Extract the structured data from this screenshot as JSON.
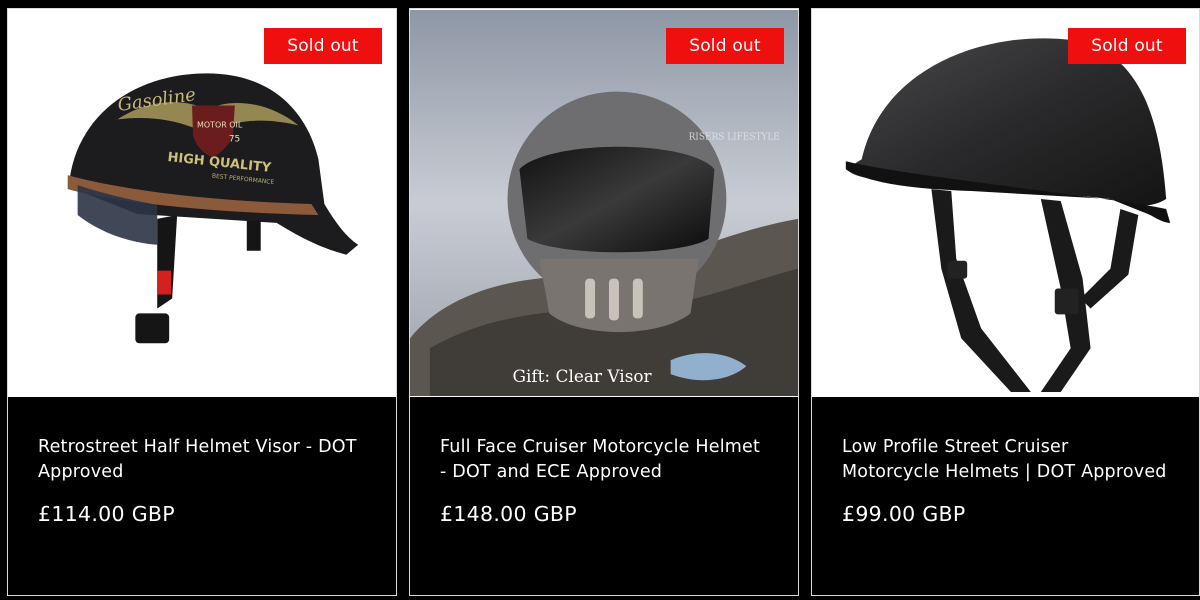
{
  "products": [
    {
      "badge": "Sold out",
      "title": "Retrostreet Half Helmet Visor - DOT Approved",
      "price": "£114.00 GBP",
      "image_text": {
        "brand": "Gasoline",
        "shield": "MOTOR OIL",
        "number": "75",
        "slogan": "HIGH QUALITY",
        "sub": "BEST PERFORMANCE"
      }
    },
    {
      "badge": "Sold out",
      "title": "Full Face Cruiser Motorcycle Helmet - DOT and ECE Approved",
      "price": "£148.00 GBP",
      "image_text": {
        "watermark": "RISERS LIFESTYLE",
        "caption": "Gift: Clear Visor"
      }
    },
    {
      "badge": "Sold out",
      "title": "Low Profile Street Cruiser Motorcycle Helmets | DOT Approved",
      "price": "£99.00 GBP"
    }
  ],
  "colors": {
    "badge": "#f00f0f",
    "card_bg": "#000000",
    "text": "#ffffff",
    "border": "#d9d9d9"
  }
}
